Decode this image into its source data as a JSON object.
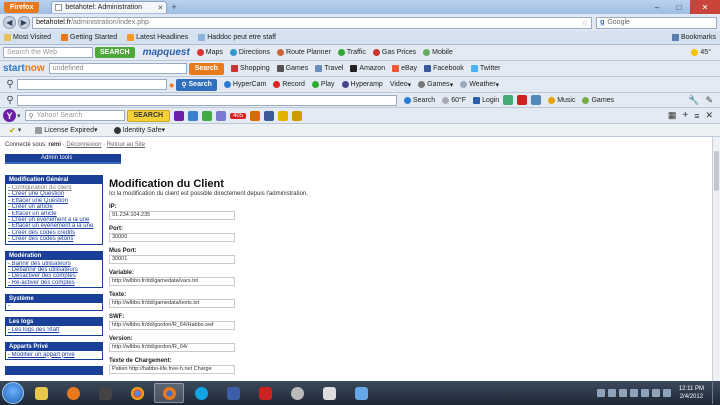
{
  "browser": {
    "menu_label": "Firefox",
    "tab_title": "betahotel: Administration",
    "url_host": "betahotel.fr",
    "url_path": "/administration/index.php",
    "search_placeholder": "Google",
    "window_controls": [
      "–",
      "□",
      "✕"
    ]
  },
  "bookmarks": {
    "items": [
      "Most Visited",
      "Getting Started",
      "Latest Headlines",
      "Haddoc peut etre staff"
    ],
    "right": "Bookmarks"
  },
  "mapquest_toolbar": {
    "search_placeholder": "Search the Web",
    "search_button": "SEARCH",
    "brand": "mapquest",
    "items": [
      "Maps",
      "Directions",
      "Route Planner",
      "Traffic",
      "Gas Prices",
      "Mobile"
    ],
    "weather": "45°"
  },
  "startnow_toolbar": {
    "brand_a": "start",
    "brand_b": "now",
    "input_value": "undefined",
    "search_button": "Search",
    "items": [
      "Shopping",
      "Games",
      "Travel",
      "Amazon",
      "eBay",
      "Facebook",
      "Twitter"
    ]
  },
  "hypercam_toolbar": {
    "search_button": "Search",
    "items": [
      "HyperCam",
      "Record",
      "Play",
      "Hyperamp",
      "Video",
      "Games",
      "Weather"
    ]
  },
  "misc_toolbar": {
    "items": [
      "Search",
      "60°F",
      "Login",
      "Music",
      "Games"
    ]
  },
  "yahoo_toolbar": {
    "search_placeholder": "Yahoo! Search",
    "search_button": "SEARCH",
    "mail_badge": "405"
  },
  "addon_bar": {
    "items": [
      "License Expired",
      "Identity Safe"
    ]
  },
  "page": {
    "breadcrumb_prefix": "Connecté sous:",
    "user": "remi",
    "logout": "Déconnexion",
    "back": "Retour au Site",
    "admin_tools": "Admin tools",
    "sidebar": [
      {
        "title": "Modification Général",
        "links": [
          "Configuration du client",
          "Créer une Question",
          "Effacer une Question",
          "Créer un article",
          "Effacer un article",
          "Créer un évènement à la une",
          "Effacer un évènement à la une",
          "Créer des codes crédits",
          "Créer des codes jetons"
        ]
      },
      {
        "title": "Modération",
        "links": [
          "Bannir des utilisateurs",
          "Débannir des utilisateurs",
          "Désactiver des comptes",
          "Ré-activer des comptes"
        ]
      },
      {
        "title": "Système",
        "links": []
      },
      {
        "title": "Les logs",
        "links": [
          "Les logs des Staff"
        ]
      },
      {
        "title": "Apparts Privé",
        "links": [
          "Modifier un appart privé"
        ]
      }
    ],
    "heading": "Modification du Client",
    "description": "Ici la modification du client est possible directement depuis l'administration.",
    "fields": [
      {
        "label": "IP:",
        "value": "91.234.104.235"
      },
      {
        "label": "Port:",
        "value": "30000"
      },
      {
        "label": "Mus Port:",
        "value": "30001"
      },
      {
        "label": "Variable:",
        "value": "http://wlbbo.fr/dd/gamedata/vars.txt"
      },
      {
        "label": "Texte:",
        "value": "http://wlbbo.fr/dd/gamedata/texts.txt"
      },
      {
        "label": "SWF:",
        "value": "http://wlbbo.fr/dd/gordon/R_64/Habbo.swf"
      },
      {
        "label": "Version:",
        "value": "http://wlbbo.fr/dd/gordon/R_64/"
      },
      {
        "label": "Texte de Chargement:",
        "value": "Patien http://habbo-life.free-h.net Charge"
      }
    ]
  },
  "taskbar": {
    "time": "12:11 PM",
    "date": "2/4/2012"
  }
}
